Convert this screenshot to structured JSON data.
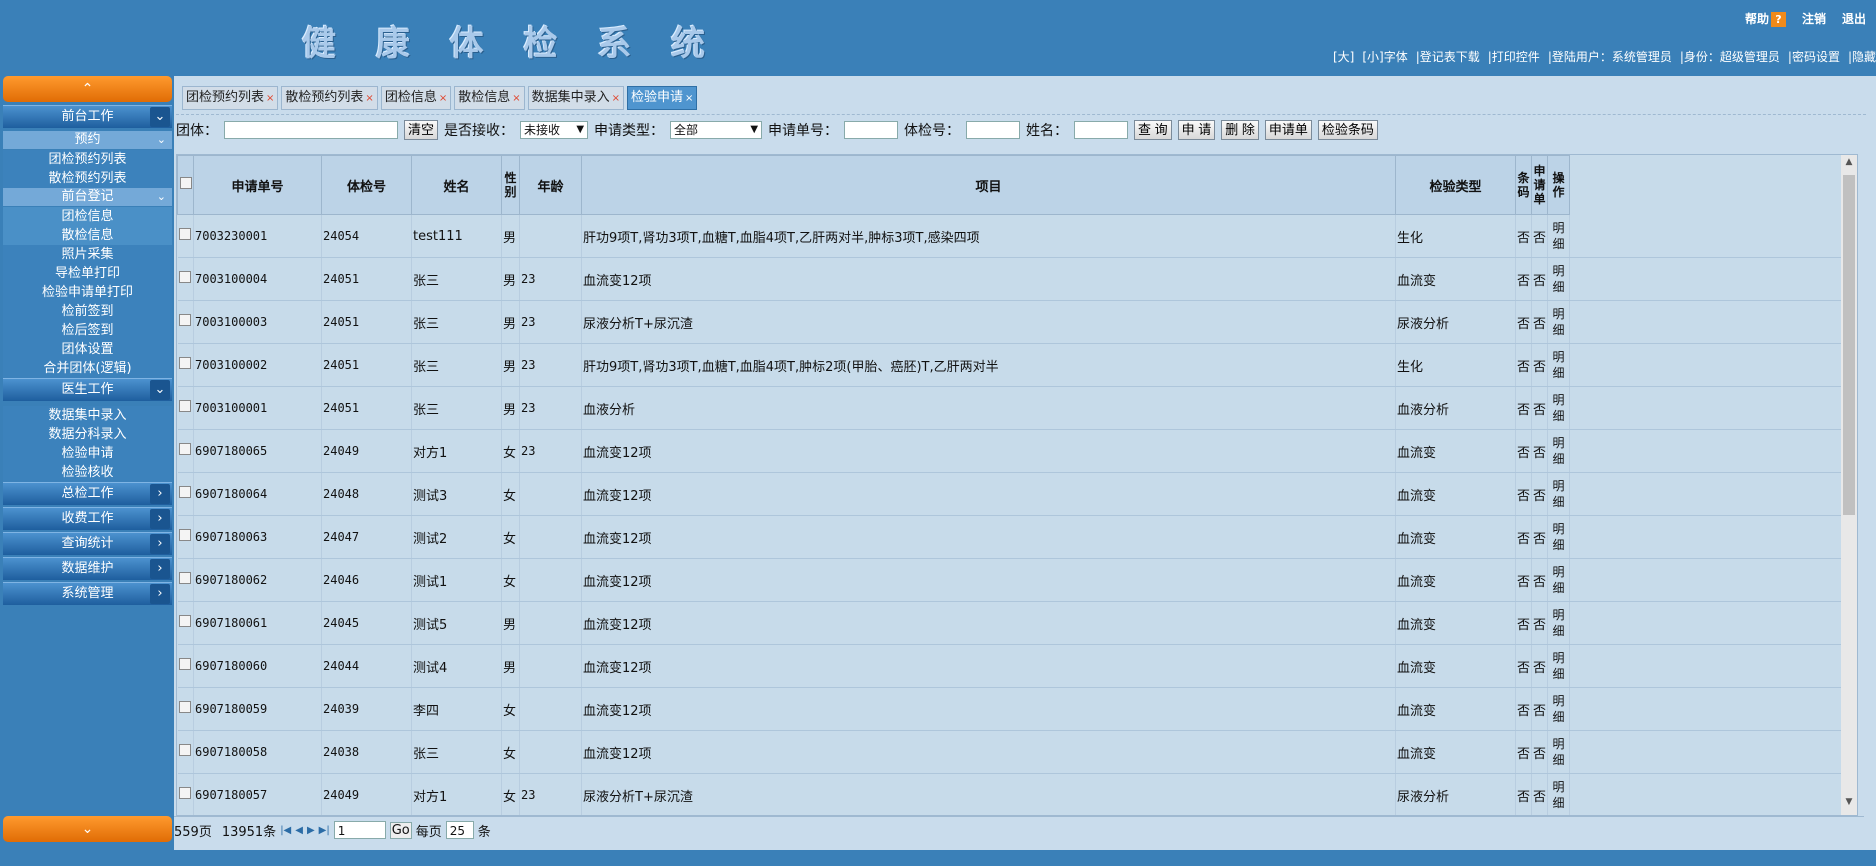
{
  "header": {
    "title": "健 康 体 检 系 统",
    "help": "帮助",
    "help_icon": "?",
    "logout": "注销",
    "exit": "退出",
    "user_bar": [
      "[大]",
      "[小]字体",
      "|登记表下载",
      "|打印控件",
      "|登陆用户：系统管理员",
      "|身份：超级管理员",
      "|密码设置",
      "|隐藏"
    ]
  },
  "sidebar": {
    "up_arrow": "⌃",
    "down_arrow": "⌄",
    "groups": [
      {
        "label": "前台工作"
      },
      {
        "label": "医生工作"
      },
      {
        "label": "总检工作"
      },
      {
        "label": "收费工作"
      },
      {
        "label": "查询统计"
      },
      {
        "label": "数据维护"
      },
      {
        "label": "系统管理"
      }
    ],
    "sub_yuyue": "预约",
    "sub_qiantai": "前台登记",
    "yuyue_items": [
      "团检预约列表",
      "散检预约列表"
    ],
    "qiantai_items": [
      "团检信息",
      "散检信息",
      "照片采集",
      "导检单打印",
      "检验申请单打印",
      "检前签到",
      "检后签到",
      "团体设置",
      "合并团体(逻辑)"
    ],
    "doctor_items": [
      "数据集中录入",
      "数据分科录入",
      "检验申请",
      "检验核收"
    ]
  },
  "tabs": [
    {
      "label": "团检预约列表",
      "close": "×"
    },
    {
      "label": "散检预约列表",
      "close": "×"
    },
    {
      "label": "团检信息",
      "close": "×"
    },
    {
      "label": "散检信息",
      "close": "×"
    },
    {
      "label": "数据集中录入",
      "close": "×"
    },
    {
      "label": "检验申请",
      "close": "×"
    }
  ],
  "search": {
    "group_label": "团体：",
    "group_value": "",
    "clear_btn": "清空",
    "received_label": "是否接收：",
    "received_value": "未接收",
    "type_label": "申请类型：",
    "type_value": "全部",
    "apply_no_label": "申请单号：",
    "exam_no_label": "体检号：",
    "name_label": "姓名：",
    "query_btn": "查 询",
    "apply_btn": "申 请",
    "delete_btn": "删 除",
    "apply_form_btn": "申请单",
    "barcode_btn": "检验条码"
  },
  "table": {
    "headers": [
      "申请单号",
      "体检号",
      "姓名",
      "性别",
      "年龄",
      "项目",
      "检验类型",
      "条码",
      "申请单",
      "操作"
    ],
    "rows": [
      {
        "no": "7003230001",
        "exam": "24054",
        "name": "test111",
        "sex": "男",
        "age": "",
        "item": "肝功9项T,肾功3项T,血糖T,血脂4项T,乙肝两对半,肿标3项T,感染四项",
        "type": "生化",
        "barcode": "否",
        "form": "否",
        "op": "明细"
      },
      {
        "no": "7003100004",
        "exam": "24051",
        "name": "张三",
        "sex": "男",
        "age": "23",
        "item": "血流变12项",
        "type": "血流变",
        "barcode": "否",
        "form": "否",
        "op": "明细"
      },
      {
        "no": "7003100003",
        "exam": "24051",
        "name": "张三",
        "sex": "男",
        "age": "23",
        "item": "尿液分析T+尿沉渣",
        "type": "尿液分析",
        "barcode": "否",
        "form": "否",
        "op": "明细"
      },
      {
        "no": "7003100002",
        "exam": "24051",
        "name": "张三",
        "sex": "男",
        "age": "23",
        "item": "肝功9项T,肾功3项T,血糖T,血脂4项T,肿标2项(甲胎、癌胚)T,乙肝两对半",
        "type": "生化",
        "barcode": "否",
        "form": "否",
        "op": "明细"
      },
      {
        "no": "7003100001",
        "exam": "24051",
        "name": "张三",
        "sex": "男",
        "age": "23",
        "item": "血液分析",
        "type": "血液分析",
        "barcode": "否",
        "form": "否",
        "op": "明细"
      },
      {
        "no": "6907180065",
        "exam": "24049",
        "name": "对方1",
        "sex": "女",
        "age": "23",
        "item": "血流变12项",
        "type": "血流变",
        "barcode": "否",
        "form": "否",
        "op": "明细"
      },
      {
        "no": "6907180064",
        "exam": "24048",
        "name": "测试3",
        "sex": "女",
        "age": "",
        "item": "血流变12项",
        "type": "血流变",
        "barcode": "否",
        "form": "否",
        "op": "明细"
      },
      {
        "no": "6907180063",
        "exam": "24047",
        "name": "测试2",
        "sex": "女",
        "age": "",
        "item": "血流变12项",
        "type": "血流变",
        "barcode": "否",
        "form": "否",
        "op": "明细"
      },
      {
        "no": "6907180062",
        "exam": "24046",
        "name": "测试1",
        "sex": "女",
        "age": "",
        "item": "血流变12项",
        "type": "血流变",
        "barcode": "否",
        "form": "否",
        "op": "明细"
      },
      {
        "no": "6907180061",
        "exam": "24045",
        "name": "测试5",
        "sex": "男",
        "age": "",
        "item": "血流变12项",
        "type": "血流变",
        "barcode": "否",
        "form": "否",
        "op": "明细"
      },
      {
        "no": "6907180060",
        "exam": "24044",
        "name": "测试4",
        "sex": "男",
        "age": "",
        "item": "血流变12项",
        "type": "血流变",
        "barcode": "否",
        "form": "否",
        "op": "明细"
      },
      {
        "no": "6907180059",
        "exam": "24039",
        "name": "李四",
        "sex": "女",
        "age": "",
        "item": "血流变12项",
        "type": "血流变",
        "barcode": "否",
        "form": "否",
        "op": "明细"
      },
      {
        "no": "6907180058",
        "exam": "24038",
        "name": "张三",
        "sex": "女",
        "age": "",
        "item": "血流变12项",
        "type": "血流变",
        "barcode": "否",
        "form": "否",
        "op": "明细"
      },
      {
        "no": "6907180057",
        "exam": "24049",
        "name": "对方1",
        "sex": "女",
        "age": "23",
        "item": "尿液分析T+尿沉渣",
        "type": "尿液分析",
        "barcode": "否",
        "form": "否",
        "op": "明细"
      }
    ]
  },
  "pager": {
    "pages": "559页",
    "records": "13951条",
    "first": "|◀",
    "prev": "◀",
    "next": "▶",
    "last": "▶|",
    "page_value": "1",
    "go": "Go",
    "per_page_label": "每页",
    "per_page_value": "25",
    "unit": "条"
  },
  "colors": {
    "header_bg": "#3a80b8",
    "accent_orange": "#f08a1a",
    "content_bg": "#c9dcec",
    "active_tab": "#4f95cf"
  }
}
